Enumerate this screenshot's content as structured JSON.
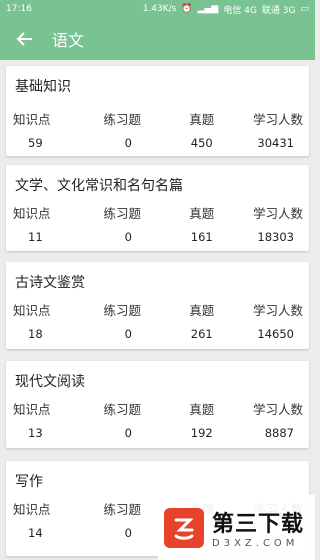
{
  "status": {
    "time": "17:16",
    "speed": "1.43K/s",
    "carrier1": "电信 4G",
    "carrier2": "联通 3G"
  },
  "appbar": {
    "title": "语文"
  },
  "columns": [
    "知识点",
    "练习题",
    "真题",
    "学习人数"
  ],
  "cards": [
    {
      "title": "基础知识",
      "values": [
        "59",
        "0",
        "450",
        "30431"
      ]
    },
    {
      "title": "文学、文化常识和名句名篇",
      "values": [
        "11",
        "0",
        "161",
        "18303"
      ]
    },
    {
      "title": "古诗文鉴赏",
      "values": [
        "18",
        "0",
        "261",
        "14650"
      ]
    },
    {
      "title": "现代文阅读",
      "values": [
        "13",
        "0",
        "192",
        "8887"
      ]
    },
    {
      "title": "写作",
      "values": [
        "14",
        "0",
        "",
        ""
      ]
    }
  ],
  "watermark": {
    "name": "第三下载",
    "domain": "D3XZ.COM"
  }
}
